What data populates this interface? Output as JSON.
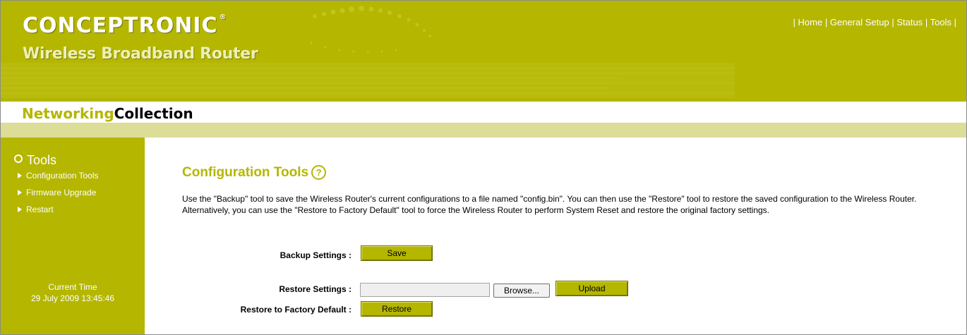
{
  "header": {
    "brand": "CONCEPTRONIC",
    "brand_mark": "®",
    "product": "Wireless Broadband Router"
  },
  "top_nav": {
    "sep": "|",
    "items": [
      "Home",
      "General Setup",
      "Status",
      "Tools"
    ]
  },
  "collection": {
    "part1": "Networking",
    "part2": "Collection"
  },
  "sidebar": {
    "title": "Tools",
    "items": [
      "Configuration Tools",
      "Firmware Upgrade",
      "Restart"
    ],
    "time_label": "Current Time",
    "time_value": "29 July 2009 13:45:46"
  },
  "main": {
    "title": "Configuration Tools",
    "help_icon": "?",
    "description": "Use the \"Backup\" tool to save the Wireless Router's current configurations to a file named \"config.bin\". You can then use the \"Restore\" tool to restore the saved configuration to the Wireless Router. Alternatively, you can use the \"Restore to Factory Default\" tool to force the Wireless Router to perform System Reset and restore the original factory settings.",
    "backup_label": "Backup Settings :",
    "save_button": "Save",
    "restore_label": "Restore Settings :",
    "file_value": "",
    "browse_button": "Browse...",
    "upload_button": "Upload",
    "factory_label": "Restore to Factory Default :",
    "restore_button": "Restore"
  },
  "colors": {
    "brand_olive": "#b4b600",
    "stripe": "#dcdd97"
  }
}
